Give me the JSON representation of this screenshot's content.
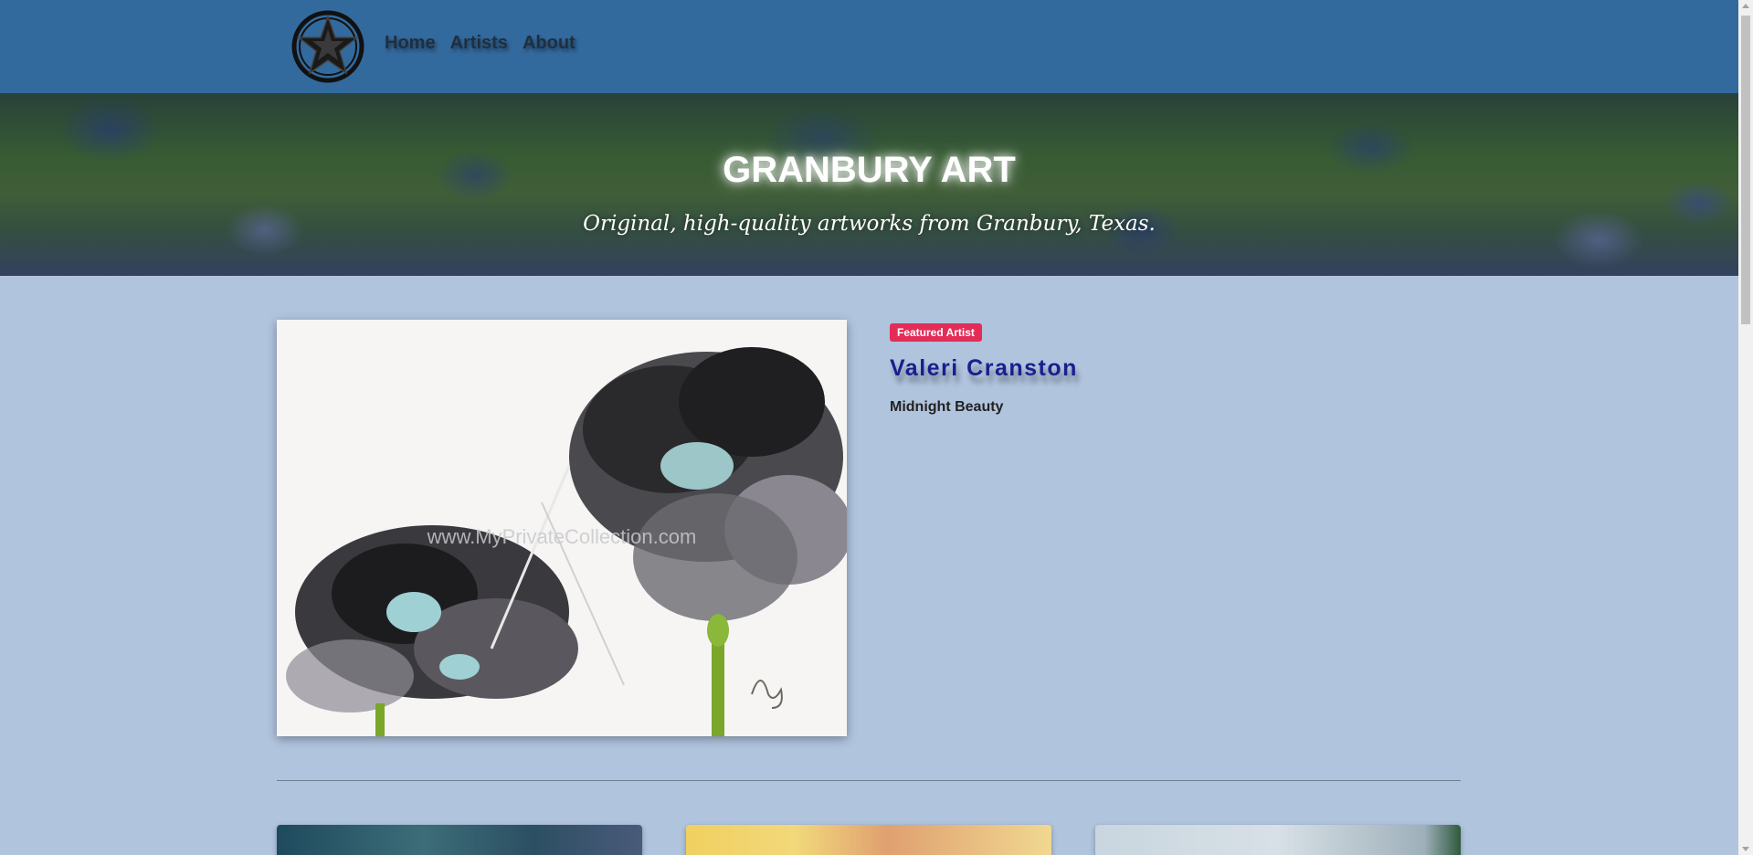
{
  "nav": {
    "logo_icon": "texas-star-icon",
    "links": [
      "Home",
      "Artists",
      "About"
    ]
  },
  "hero": {
    "title": "GRANBURY ART",
    "subtitle": "Original, high-quality artworks from Granbury, Texas."
  },
  "featured": {
    "badge": "Featured Artist",
    "artist_name": "Valeri Cranston",
    "artwork_title": "Midnight Beauty",
    "watermark": "www.MyPrivateCollection.com"
  },
  "colors": {
    "navbar": "#336a9e",
    "page_background": "#b0c4de",
    "badge": "#e32d57",
    "artist_name": "#1a1e8e"
  }
}
